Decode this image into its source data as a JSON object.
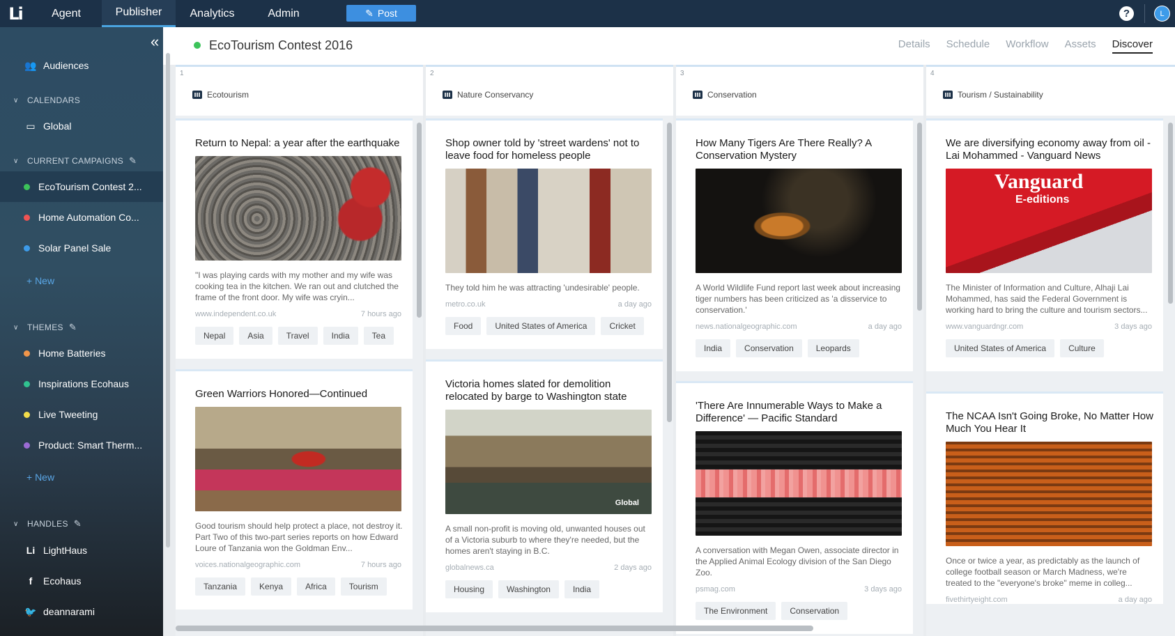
{
  "app": {
    "logo": "Li"
  },
  "topnav": [
    {
      "label": "Agent",
      "active": false
    },
    {
      "label": "Publisher",
      "active": true
    },
    {
      "label": "Analytics",
      "active": false
    },
    {
      "label": "Admin",
      "active": false
    }
  ],
  "post_button": {
    "label": "Post"
  },
  "help": {
    "label": "?"
  },
  "user": {
    "initial": "L"
  },
  "sidebar": {
    "audiences": "Audiences",
    "calendars_header": "CALENDARS",
    "calendar_global": "Global",
    "campaigns_header": "CURRENT CAMPAIGNS",
    "campaigns": [
      {
        "label": "EcoTourism Contest 2...",
        "color": "#3cc35a",
        "active": true
      },
      {
        "label": "Home Automation Co...",
        "color": "#ef5353",
        "active": false
      },
      {
        "label": "Solar Panel Sale",
        "color": "#3d9be9",
        "active": false
      }
    ],
    "new_campaign": "+ New",
    "themes_header": "THEMES",
    "themes": [
      {
        "label": "Home Batteries",
        "color": "#f0954a"
      },
      {
        "label": "Inspirations Ecohaus",
        "color": "#30c290"
      },
      {
        "label": "Live Tweeting",
        "color": "#f3dd4a"
      },
      {
        "label": "Product: Smart Therm...",
        "color": "#9b6bd4"
      }
    ],
    "new_theme": "+ New",
    "handles_header": "HANDLES",
    "handles": [
      {
        "label": "LightHaus",
        "icon": "Li"
      },
      {
        "label": "Ecohaus",
        "icon": "f"
      },
      {
        "label": "deannarami",
        "icon": "t"
      }
    ]
  },
  "campaign": {
    "title": "EcoTourism Contest 2016"
  },
  "tabs": [
    {
      "label": "Details",
      "active": false
    },
    {
      "label": "Schedule",
      "active": false
    },
    {
      "label": "Workflow",
      "active": false
    },
    {
      "label": "Assets",
      "active": false
    },
    {
      "label": "Discover",
      "active": true
    }
  ],
  "columns": [
    {
      "number": "1",
      "label": "Ecotourism",
      "cards": [
        {
          "title": "Return to Nepal: a year after the earthquake",
          "image": "pigeons",
          "desc": "\"I was playing cards with my mother and my wife was cooking tea in the kitchen. We ran out and clutched the frame of the front door. My wife was cryin...",
          "source": "www.independent.co.uk",
          "time": "7 hours ago",
          "tags": [
            "Nepal",
            "Asia",
            "Travel",
            "India",
            "Tea"
          ]
        },
        {
          "title": "Green Warriors Honored—Continued",
          "image": "warriors",
          "desc": "Good tourism should help protect a place, not destroy it. Part Two of this two-part series reports on how Edward Loure of Tanzania won the Goldman Env...",
          "source": "voices.nationalgeographic.com",
          "time": "7 hours ago",
          "tags": [
            "Tanzania",
            "Kenya",
            "Africa",
            "Tourism"
          ]
        }
      ]
    },
    {
      "number": "2",
      "label": "Nature Conservancy",
      "cards": [
        {
          "title": "Shop owner told by 'street wardens' not to leave food for homeless people",
          "image": "shop",
          "desc": "They told him he was attracting 'undesirable' people.",
          "source": "metro.co.uk",
          "time": "a day ago",
          "tags": [
            "Food",
            "United States of America",
            "Cricket"
          ]
        },
        {
          "title": "Victoria homes slated for demolition relocated by barge to Washington state",
          "image": "house",
          "image_text": "Global",
          "desc": "A small non-profit is moving old, unwanted houses out of a Victoria suburb to where they're needed, but the homes aren't staying in B.C.",
          "source": "globalnews.ca",
          "time": "2 days ago",
          "tags": [
            "Housing",
            "Washington",
            "India"
          ]
        }
      ]
    },
    {
      "number": "3",
      "label": "Conservation",
      "cards": [
        {
          "title": "How Many Tigers Are There Really? A Conservation Mystery",
          "image": "tiger",
          "desc": "A World Wildlife Fund report last week about increasing tiger numbers has been criticized as 'a disservice to conservation.'",
          "source": "news.nationalgeographic.com",
          "time": "a day ago",
          "tags": [
            "India",
            "Conservation",
            "Leopards"
          ]
        },
        {
          "title": "'There Are Innumerable Ways to Make a Difference' — Pacific Standard",
          "image": "ways",
          "desc": "A conversation with Megan Owen, associate director in the Applied Animal Ecology division of the San Diego Zoo.",
          "source": "psmag.com",
          "time": "3 days ago",
          "tags": [
            "The Environment",
            "Conservation"
          ]
        }
      ]
    },
    {
      "number": "4",
      "label": "Tourism / Sustainability",
      "cards": [
        {
          "title": "We are diversifying economy away from oil - Lai Mohammed - Vanguard News",
          "image": "vanguard",
          "image_text": "Vanguard",
          "image_subtext": "E-editions",
          "desc": "The Minister of Information and Culture, Alhaji Lai Mohammed, has said the Federal Government is working hard to bring the culture and tourism sectors...",
          "source": "www.vanguardngr.com",
          "time": "3 days ago",
          "tags": [
            "United States of America",
            "Culture"
          ]
        },
        {
          "title": "The NCAA Isn't Going Broke, No Matter How Much You Hear It",
          "image": "stadium",
          "desc": "Once or twice a year, as predictably as the launch of college football season or March Madness, we're treated to the \"everyone's broke\" meme in colleg...",
          "source": "fivethirtyeight.com",
          "time": "a day ago",
          "tags": []
        }
      ]
    }
  ]
}
